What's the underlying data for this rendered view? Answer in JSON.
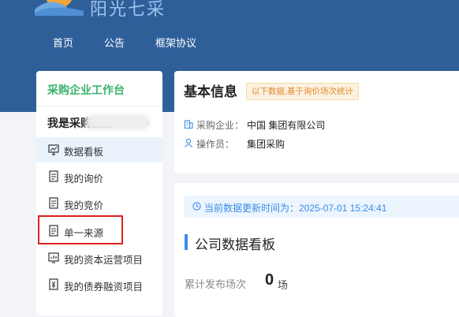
{
  "brand": {
    "name": "阳光七采"
  },
  "nav": [
    {
      "label": "首页"
    },
    {
      "label": "公告"
    },
    {
      "label": "框架协议"
    }
  ],
  "sidebar": {
    "title": "采购企业工作台",
    "group": "我是采购企业",
    "items": [
      {
        "label": "数据看板",
        "icon": "monitor-icon",
        "active": true
      },
      {
        "label": "我的询价",
        "icon": "document-icon"
      },
      {
        "label": "我的竞价",
        "icon": "document-icon"
      },
      {
        "label": "单一来源",
        "icon": "document-icon"
      },
      {
        "label": "我的资本运营项目",
        "icon": "chart-screen-icon"
      },
      {
        "label": "我的债券融资项目",
        "icon": "yen-document-icon"
      }
    ]
  },
  "basic_info": {
    "title": "基本信息",
    "badge": "以下数据,基于询价场次统计",
    "company_label": "采购企业：",
    "company_value": "中国                    集团有限公司",
    "operator_label": "操作员：",
    "operator_value": "集团采购"
  },
  "dashboard": {
    "notice": "当前数据更新时间为：2025-07-01 15:24:41",
    "title": "公司数据看板",
    "stat_label": "累计发布场次",
    "stat_value": "0",
    "stat_unit": "场"
  },
  "colors": {
    "header": "#2f5f99",
    "accent_green": "#3ab26c",
    "accent_blue": "#3a8de8",
    "badge_orange": "#e08a2d",
    "highlight_red": "#e02020"
  }
}
